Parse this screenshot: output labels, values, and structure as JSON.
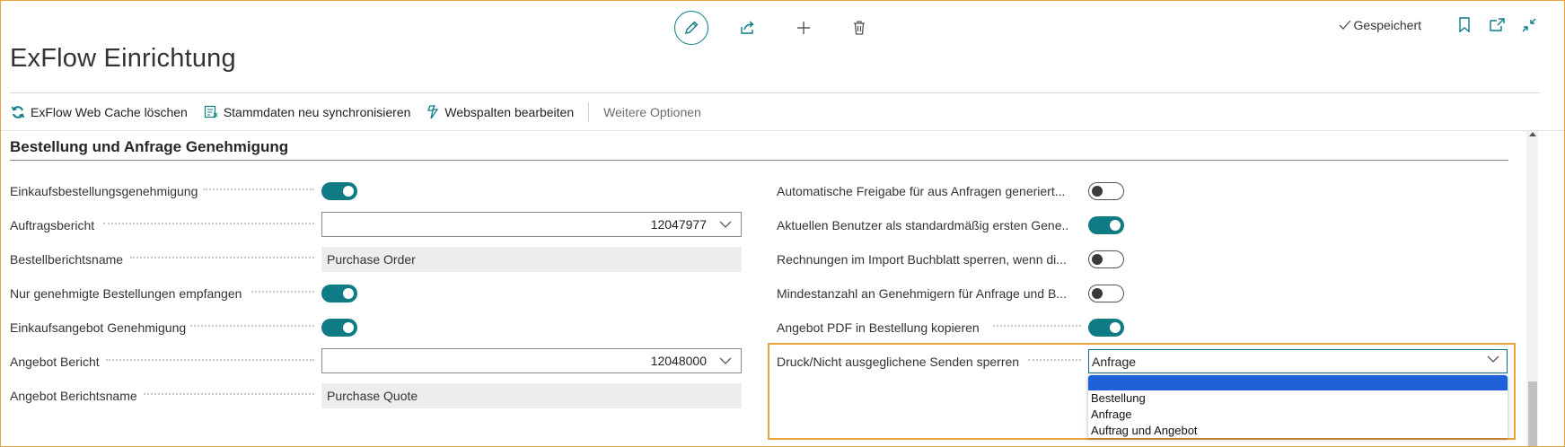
{
  "page": {
    "title": "ExFlow Einrichtung",
    "status": "Gespeichert"
  },
  "icons": {
    "edit": "pencil-icon",
    "share": "share-icon",
    "new": "plus-icon",
    "delete": "trash-icon",
    "bookmark": "bookmark-icon",
    "open_new": "open-in-new-window-icon",
    "collapse": "collapse-icon"
  },
  "toolbar": {
    "items": [
      {
        "label": "ExFlow Web Cache löschen",
        "icon": "refresh-icon"
      },
      {
        "label": "Stammdaten neu synchronisieren",
        "icon": "sync-data-icon"
      },
      {
        "label": "Webspalten bearbeiten",
        "icon": "edit-columns-icon"
      }
    ],
    "more": "Weitere Optionen"
  },
  "section": {
    "title": "Bestellung und Anfrage Genehmigung",
    "left": [
      {
        "label": "Einkaufsbestellungsgenehmigung",
        "type": "toggle",
        "on": true
      },
      {
        "label": "Auftragsbericht",
        "type": "select",
        "value": "12047977"
      },
      {
        "label": "Bestellberichtsname",
        "type": "readonly",
        "value": "Purchase Order"
      },
      {
        "label": "Nur genehmigte Bestellungen empfangen",
        "type": "toggle",
        "on": true
      },
      {
        "label": "Einkaufsangebot Genehmigung",
        "type": "toggle",
        "on": true
      },
      {
        "label": "Angebot Bericht",
        "type": "select",
        "value": "12048000"
      },
      {
        "label": "Angebot Berichtsname",
        "type": "readonly",
        "value": "Purchase Quote"
      }
    ],
    "right": [
      {
        "label": "Automatische Freigabe für aus Anfragen generiert...",
        "type": "toggle",
        "on": false
      },
      {
        "label": "Aktuellen Benutzer als standardmäßig ersten Gene...",
        "type": "toggle",
        "on": true
      },
      {
        "label": "Rechnungen im Import Buchblatt sperren, wenn di...",
        "type": "toggle",
        "on": false
      },
      {
        "label": "Mindestanzahl an Genehmigern für Anfrage und B...",
        "type": "toggle",
        "on": false
      },
      {
        "label": "Angebot PDF in Bestellung kopieren",
        "type": "toggle",
        "on": true
      }
    ],
    "dropdown_field": {
      "label": "Druck/Nicht ausgeglichene Senden sperren",
      "value": "Anfrage",
      "options": [
        "",
        "Bestellung",
        "Anfrage",
        "Auftrag und Angebot"
      ],
      "highlighted_index": 0
    }
  },
  "colors": {
    "accent": "#0f7b85",
    "highlight_frame": "#e8a33d",
    "dropdown_selection": "#1e61d8"
  }
}
